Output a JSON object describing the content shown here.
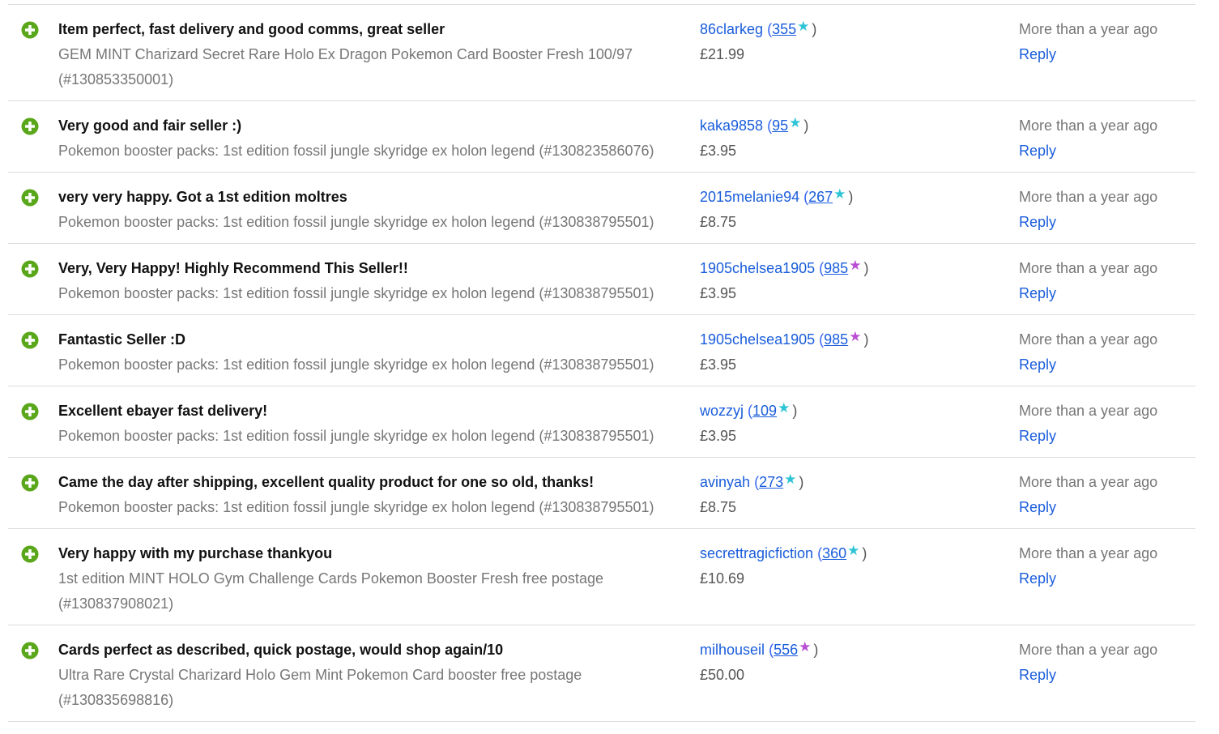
{
  "colors": {
    "positive_icon": "#5ba71b",
    "star_teal": "#2ec4d6",
    "star_purple": "#b84fd3",
    "link": "#1a5ddb",
    "muted_text": "#767676"
  },
  "icons": {
    "positive": "plus-circle-icon",
    "star": "star-icon"
  },
  "feedback": [
    {
      "comment": "Item perfect, fast delivery and good comms, great seller",
      "item": "GEM MINT Charizard Secret Rare Holo Ex Dragon Pokemon Card Booster Fresh 100/97 (#130853350001)",
      "user": "86clarkeg",
      "score": "355",
      "star_color": "teal",
      "price": "£21.99",
      "time": "More than a year ago",
      "reply": "Reply",
      "height": 119
    },
    {
      "comment": "Very good and fair seller :)",
      "item": "Pokemon booster packs: 1st edition fossil jungle skyridge ex holon legend (#130823586076)",
      "user": "kaka9858",
      "score": "95",
      "star_color": "teal",
      "price": "£3.95",
      "time": "More than a year ago",
      "reply": "Reply",
      "height": 88
    },
    {
      "comment": "very very happy. Got a 1st edition moltres",
      "item": "Pokemon booster packs: 1st edition fossil jungle skyridge ex holon legend (#130838795501)",
      "user": "2015melanie94",
      "score": "267",
      "star_color": "teal",
      "price": "£8.75",
      "time": "More than a year ago",
      "reply": "Reply",
      "height": 88
    },
    {
      "comment": "Very, Very Happy! Highly Recommend This Seller!!",
      "item": "Pokemon booster packs: 1st edition fossil jungle skyridge ex holon legend (#130838795501)",
      "user": "1905chelsea1905",
      "score": "985",
      "star_color": "purple",
      "price": "£3.95",
      "time": "More than a year ago",
      "reply": "Reply",
      "height": 88
    },
    {
      "comment": "Fantastic Seller :D",
      "item": "Pokemon booster packs: 1st edition fossil jungle skyridge ex holon legend (#130838795501)",
      "user": "1905chelsea1905",
      "score": "985",
      "star_color": "purple",
      "price": "£3.95",
      "time": "More than a year ago",
      "reply": "Reply",
      "height": 88
    },
    {
      "comment": "Excellent ebayer fast delivery!",
      "item": "Pokemon booster packs: 1st edition fossil jungle skyridge ex holon legend (#130838795501)",
      "user": "wozzyj",
      "score": "109",
      "star_color": "teal",
      "price": "£3.95",
      "time": "More than a year ago",
      "reply": "Reply",
      "height": 88
    },
    {
      "comment": "Came the day after shipping, excellent quality product for one so old, thanks!",
      "item": "Pokemon booster packs: 1st edition fossil jungle skyridge ex holon legend (#130838795501)",
      "user": "avinyah",
      "score": "273",
      "star_color": "teal",
      "price": "£8.75",
      "time": "More than a year ago",
      "reply": "Reply",
      "height": 88
    },
    {
      "comment": "Very happy with my purchase thankyou",
      "item": "1st edition MINT HOLO Gym Challenge Cards Pokemon Booster Fresh free postage (#130837908021)",
      "user": "secrettragicfiction",
      "score": "360",
      "star_color": "teal",
      "price": "£10.69",
      "time": "More than a year ago",
      "reply": "Reply",
      "height": 119
    },
    {
      "comment": "Cards perfect as described, quick postage, would shop again/10",
      "item": "Ultra Rare Crystal Charizard Holo Gem Mint Pokemon Card booster free postage (#130835698816)",
      "user": "milhouseil",
      "score": "556",
      "star_color": "purple",
      "price": "£50.00",
      "time": "More than a year ago",
      "reply": "Reply",
      "height": 119
    }
  ]
}
